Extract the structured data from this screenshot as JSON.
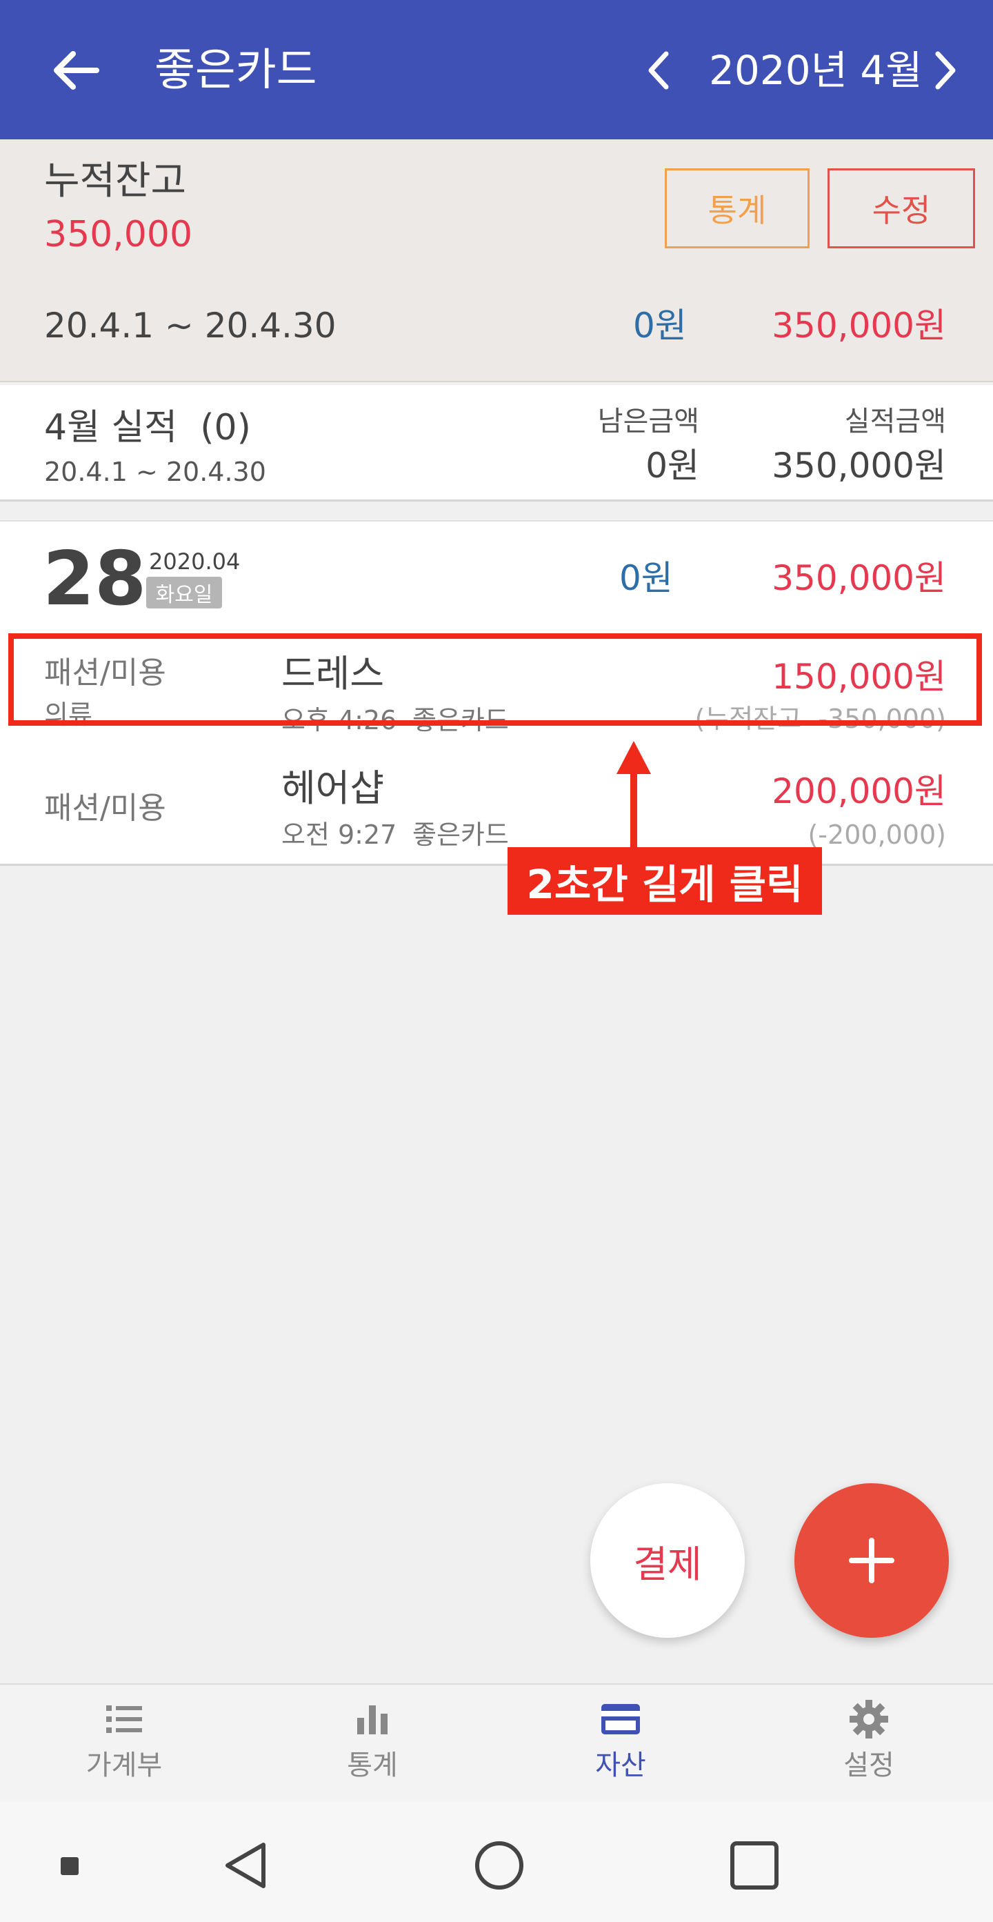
{
  "header": {
    "title": "좋은카드",
    "month": "2020년 4월"
  },
  "balance": {
    "label": "누적잔고",
    "value": "350,000",
    "stats_button": "통계",
    "edit_button": "수정",
    "range": "20.4.1 ~ 20.4.30",
    "income": "0원",
    "expense": "350,000원"
  },
  "performance": {
    "title": "4월 실적  (0)",
    "range": "20.4.1 ~ 20.4.30",
    "remaining_label": "남은금액",
    "remaining_value": "0원",
    "amount_label": "실적금액",
    "amount_value": "350,000원"
  },
  "day": {
    "number": "28",
    "year_month": "2020.04",
    "weekday": "화요일",
    "income": "0원",
    "expense": "350,000원"
  },
  "transactions": [
    {
      "category": "패션/미용",
      "subcategory": "의류",
      "name": "드레스",
      "time": "오후 4:26",
      "card": "좋은카드",
      "amount": "150,000원",
      "balance": "(누적잔고  -350,000)"
    },
    {
      "category": "패션/미용",
      "subcategory": "",
      "name": "헤어샵",
      "time": "오전 9:27",
      "card": "좋은카드",
      "amount": "200,000원",
      "balance": "(-200,000)"
    }
  ],
  "annotation": {
    "callout": "2초간 길게 클릭"
  },
  "fab": {
    "pay": "결제",
    "add": "+"
  },
  "bottom_nav": [
    {
      "label": "가계부",
      "icon": "list-icon"
    },
    {
      "label": "통계",
      "icon": "bar-chart-icon"
    },
    {
      "label": "자산",
      "icon": "card-icon",
      "active": true
    },
    {
      "label": "설정",
      "icon": "gear-icon"
    }
  ],
  "colors": {
    "primary": "#3f51b5",
    "expense": "#e53950",
    "income": "#2d6ea8",
    "accent": "#e74c3c",
    "highlight": "#f02a1a"
  }
}
